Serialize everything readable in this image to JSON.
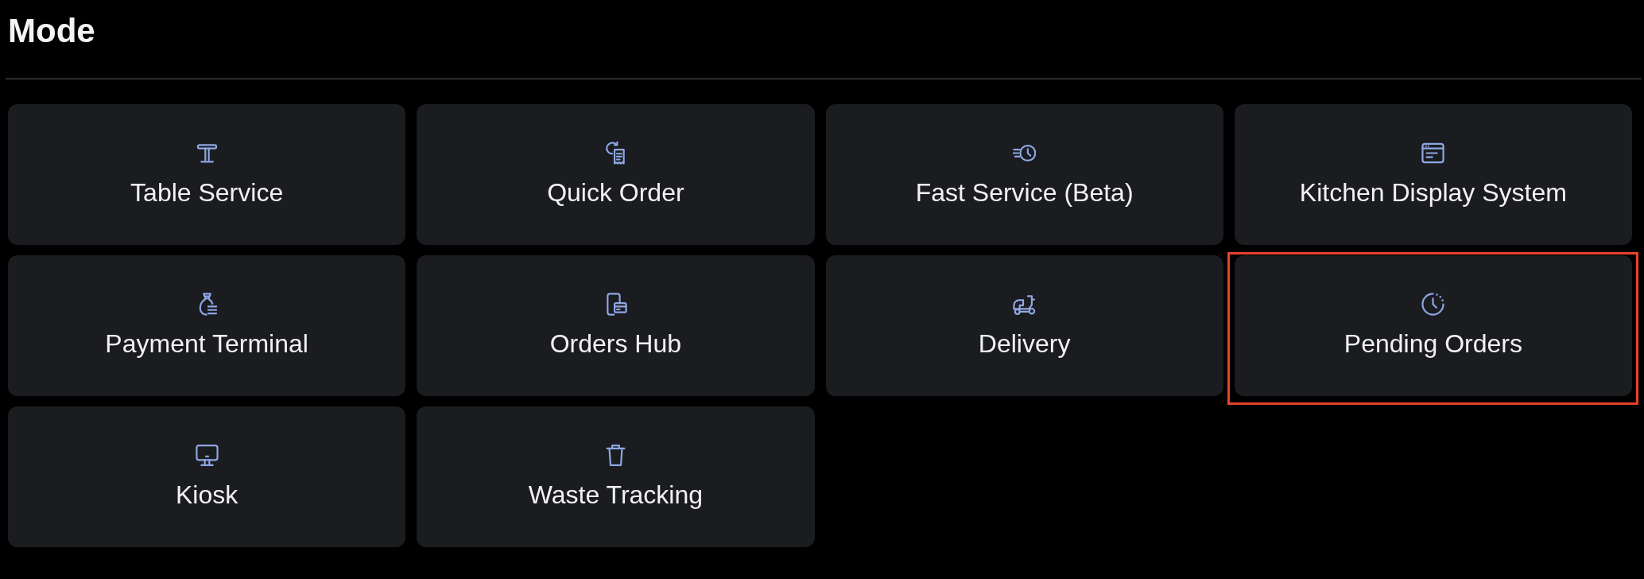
{
  "title": "Mode",
  "modes": [
    {
      "label": "Table Service",
      "kind": "table",
      "highlighted": false
    },
    {
      "label": "Quick Order",
      "kind": "quick",
      "highlighted": false
    },
    {
      "label": "Fast Service (Beta)",
      "kind": "fast",
      "highlighted": false
    },
    {
      "label": "Kitchen Display System",
      "kind": "kitchen",
      "highlighted": false
    },
    {
      "label": "Payment Terminal",
      "kind": "payment",
      "highlighted": false
    },
    {
      "label": "Orders Hub",
      "kind": "hub",
      "highlighted": false
    },
    {
      "label": "Delivery",
      "kind": "delivery",
      "highlighted": false
    },
    {
      "label": "Pending Orders",
      "kind": "pending",
      "highlighted": true
    },
    {
      "label": "Kiosk",
      "kind": "kiosk",
      "highlighted": false
    },
    {
      "label": "Waste Tracking",
      "kind": "waste",
      "highlighted": false
    }
  ]
}
